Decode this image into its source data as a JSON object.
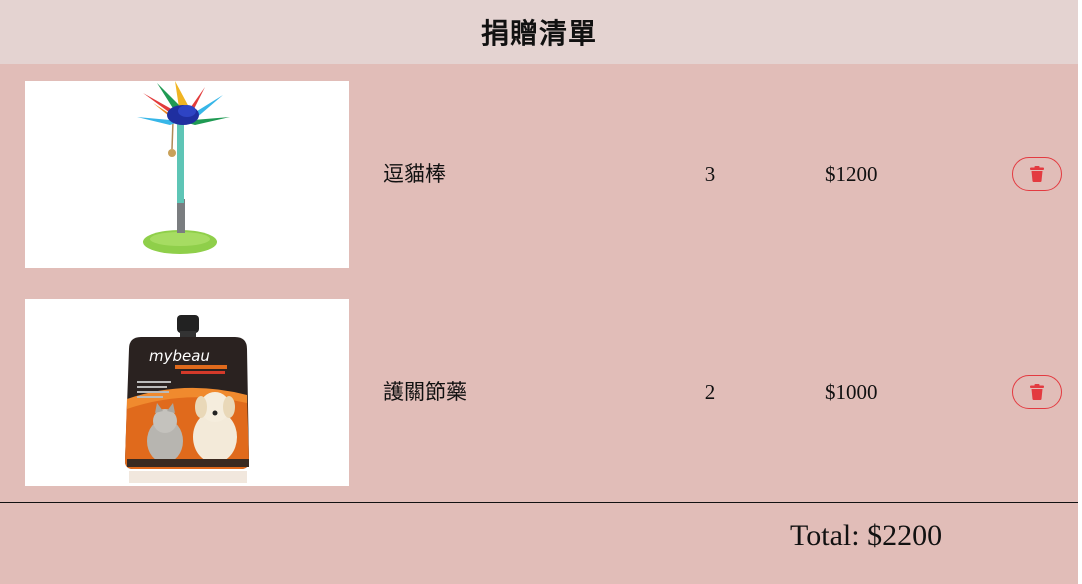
{
  "header": {
    "title": "捐贈清單"
  },
  "items": [
    {
      "name": "逗貓棒",
      "quantity": "3",
      "price": "$1200",
      "image_icon": "cat-teaser-wand-image",
      "delete_icon": "trash-icon"
    },
    {
      "name": "護關節藥",
      "quantity": "2",
      "price": "$1000",
      "image_icon": "pet-joint-supplement-pouch-image",
      "delete_icon": "trash-icon"
    }
  ],
  "summary": {
    "total_label": "Total:",
    "total_value": "$2200"
  },
  "colors": {
    "page_background": "#e1bdb8",
    "header_background": "#e4d3d1",
    "delete_accent": "#e33a40",
    "product_packaging": "#e06a1c"
  }
}
